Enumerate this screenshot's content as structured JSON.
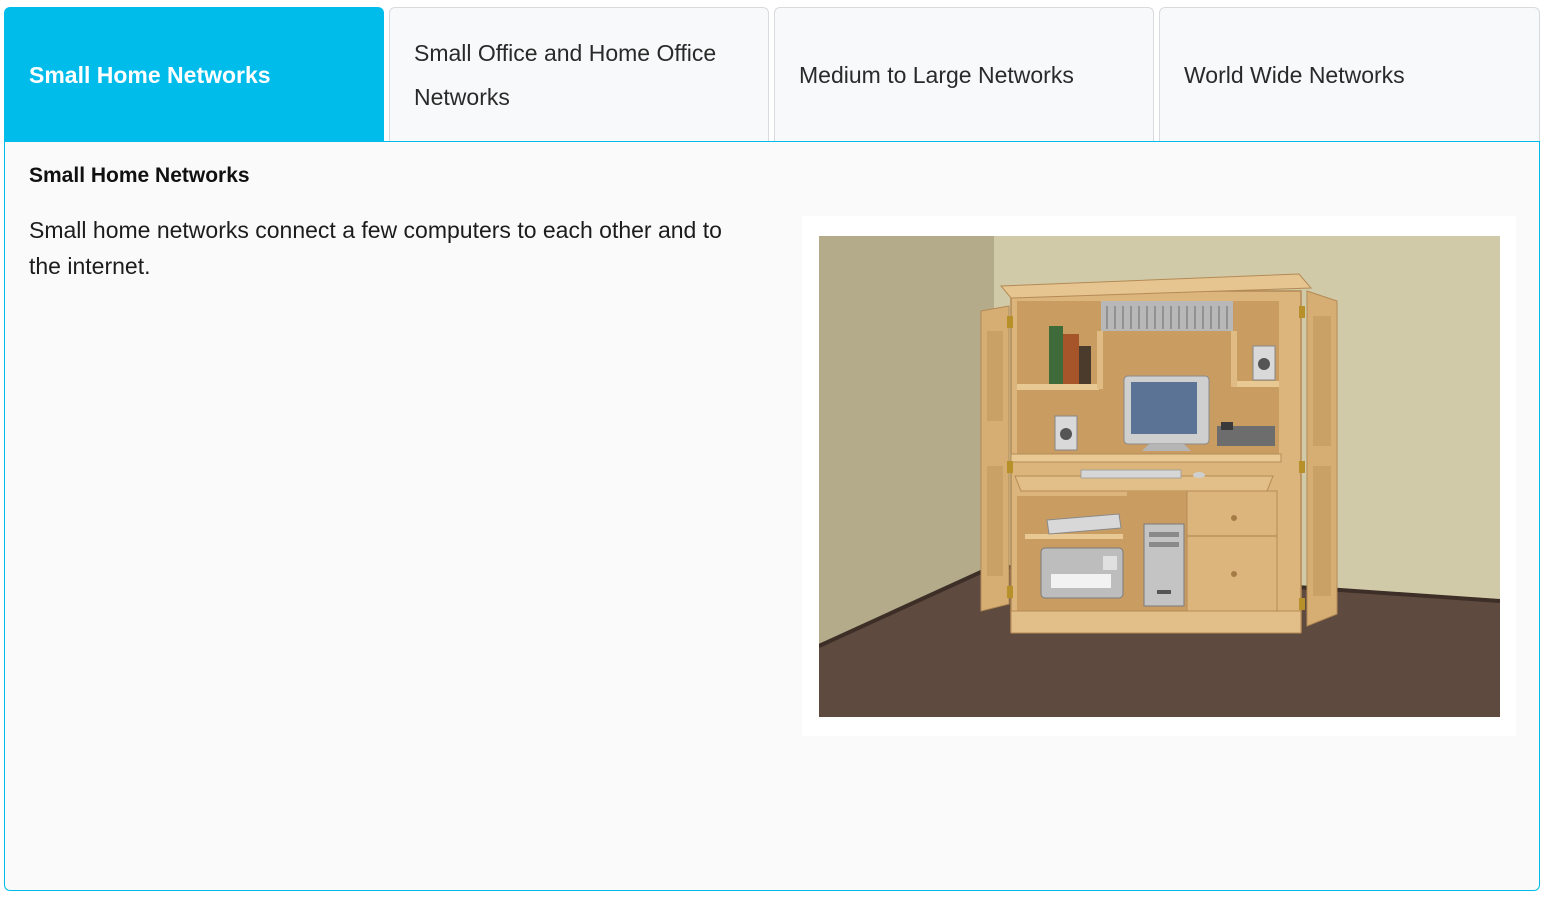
{
  "tabs": [
    {
      "label": "Small Home Networks",
      "active": true
    },
    {
      "label": "Small Office and Home Office Networks",
      "active": false
    },
    {
      "label": "Medium to Large Networks",
      "active": false
    },
    {
      "label": "World Wide Networks",
      "active": false
    }
  ],
  "panel": {
    "title": "Small Home Networks",
    "body": "Small home networks connect a few computers to each other and to the internet."
  },
  "colors": {
    "accent": "#00bceb",
    "wall": "#cfc8a6",
    "floor": "#5e4a3e",
    "wood": "#dcb57c"
  }
}
